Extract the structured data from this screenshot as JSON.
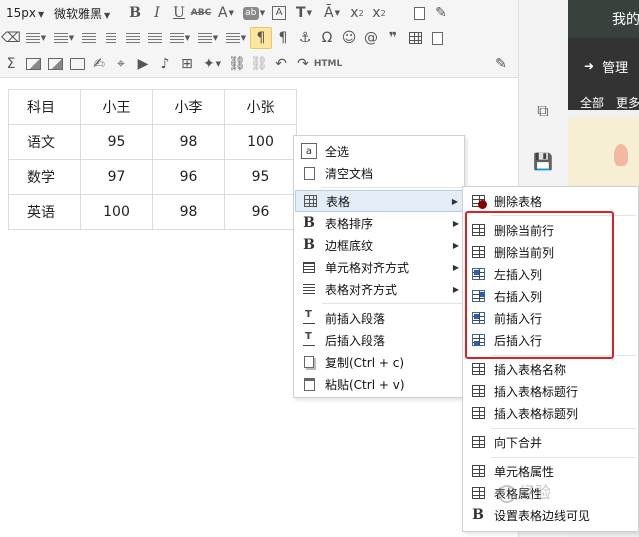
{
  "toolbar": {
    "font_size": "15px",
    "font_family": "微软雅黑",
    "html_label": "HTML"
  },
  "right_panel": {
    "title": "我的",
    "manage_label": "管理",
    "tab_all": "全部",
    "tab_more": "更多"
  },
  "table": {
    "headers": [
      "科目",
      "小王",
      "小李",
      "小张"
    ],
    "rows": [
      [
        "语文",
        "95",
        "98",
        "100"
      ],
      [
        "数学",
        "97",
        "96",
        "95"
      ],
      [
        "英语",
        "100",
        "98",
        "96"
      ]
    ]
  },
  "context_menu": {
    "items": [
      {
        "label": "全选",
        "icon": "select-all-icon"
      },
      {
        "label": "清空文档",
        "icon": "clear-document-icon"
      },
      {
        "label": "表格",
        "icon": "table-icon"
      },
      {
        "label": "表格排序",
        "icon": "bold-b-icon"
      },
      {
        "label": "边框底纹",
        "icon": "bold-b-icon"
      },
      {
        "label": "单元格对齐方式",
        "icon": "align-lines-icon"
      },
      {
        "label": "表格对齐方式",
        "icon": "align-lines-icon"
      },
      {
        "label": "前插入段落",
        "icon": "insert-paragraph-before-icon"
      },
      {
        "label": "后插入段落",
        "icon": "insert-paragraph-after-icon"
      },
      {
        "label": "复制(Ctrl + c)",
        "icon": "copy-icon"
      },
      {
        "label": "粘贴(Ctrl + v)",
        "icon": "paste-icon"
      }
    ]
  },
  "submenu": {
    "items": [
      {
        "label": "删除表格",
        "icon": "delete-table-icon"
      },
      {
        "label": "删除当前行",
        "icon": "delete-row-icon"
      },
      {
        "label": "删除当前列",
        "icon": "delete-column-icon"
      },
      {
        "label": "左插入列",
        "icon": "insert-column-left-icon"
      },
      {
        "label": "右插入列",
        "icon": "insert-column-right-icon"
      },
      {
        "label": "前插入行",
        "icon": "insert-row-before-icon"
      },
      {
        "label": "后插入行",
        "icon": "insert-row-after-icon"
      },
      {
        "label": "插入表格名称",
        "icon": "insert-caption-icon"
      },
      {
        "label": "插入表格标题行",
        "icon": "insert-title-row-icon"
      },
      {
        "label": "插入表格标题列",
        "icon": "insert-title-column-icon"
      },
      {
        "label": "向下合并",
        "icon": "merge-down-icon"
      },
      {
        "label": "单元格属性",
        "icon": "cell-properties-icon"
      },
      {
        "label": "表格属性",
        "icon": "table-properties-icon"
      },
      {
        "label": "设置表格边线可见",
        "icon": "bold-b-icon"
      }
    ]
  },
  "watermark": "经验",
  "colors": {
    "highlight_frame": "#e02020",
    "menu_hover": "#e3edf8",
    "dark_panel": "#333333",
    "active_button": "#ffe69f"
  }
}
